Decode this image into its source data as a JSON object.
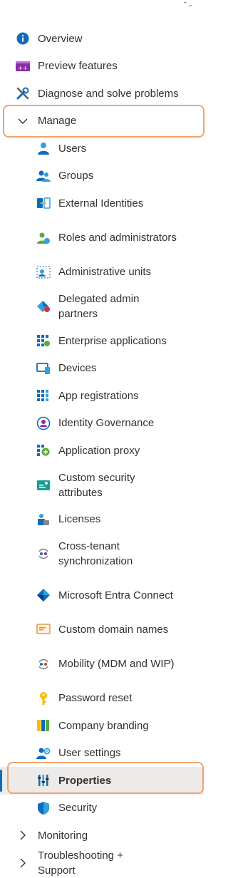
{
  "scroll_caret": "⌃⌄",
  "nav": {
    "overview": "Overview",
    "preview_features": "Preview features",
    "diagnose": "Diagnose and solve problems",
    "manage": "Manage",
    "manage_items": [
      "Users",
      "Groups",
      "External Identities",
      "Roles and administrators",
      "Administrative units",
      "Delegated admin partners",
      "Enterprise applications",
      "Devices",
      "App registrations",
      "Identity Governance",
      "Application proxy",
      "Custom security attributes",
      "Licenses",
      "Cross-tenant synchronization",
      "Microsoft Entra Connect",
      "Custom domain names",
      "Mobility (MDM and WIP)",
      "Password reset",
      "Company branding",
      "User settings",
      "Properties",
      "Security"
    ],
    "monitoring": "Monitoring",
    "troubleshooting": "Troubleshooting + Support"
  },
  "selected_item": "Properties",
  "colors": {
    "accent": "#0f6cbd",
    "highlight_outline": "#f2a36b",
    "selected_bg": "#edebe9"
  }
}
